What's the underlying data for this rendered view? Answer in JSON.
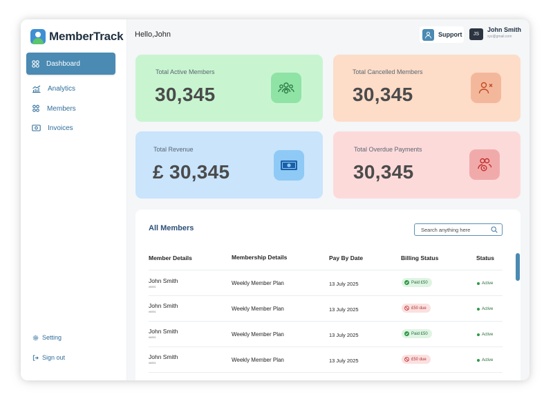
{
  "app": {
    "name": "MemberTrack"
  },
  "sidebar": {
    "items": [
      {
        "label": "Dashboard",
        "icon": "dashboard-icon",
        "active": true
      },
      {
        "label": "Analytics",
        "icon": "analytics-icon",
        "active": false
      },
      {
        "label": "Members",
        "icon": "members-icon",
        "active": false
      },
      {
        "label": "Invoices",
        "icon": "invoices-icon",
        "active": false
      }
    ],
    "bottom": [
      {
        "label": "Setting",
        "icon": "gear-icon"
      },
      {
        "label": "Sign out",
        "icon": "sign-out-icon"
      }
    ]
  },
  "header": {
    "greeting": "Hello,John",
    "support_label": "Support",
    "user": {
      "initials": "JS",
      "name": "John Smith",
      "email": "xyz@gmail.com"
    }
  },
  "stats": [
    {
      "label": "Total Active Members",
      "value": "30,345",
      "icon": "active-members-icon",
      "bg": "#c8f5d0",
      "icon_bg": "#8fe3a5",
      "icon_color": "#2c7a45"
    },
    {
      "label": "Total Cancelled Members",
      "value": "30,345",
      "icon": "cancelled-member-icon",
      "bg": "#fddcc8",
      "icon_bg": "#f3b89b",
      "icon_color": "#c24a23"
    },
    {
      "label": "Total Revenue",
      "value": "£ 30,345",
      "icon": "money-icon",
      "bg": "#c9e4fb",
      "icon_bg": "#8ecaf5",
      "icon_color": "#1a5ea8"
    },
    {
      "label": "Total Overdue Payments",
      "value": "30,345",
      "icon": "overdue-payment-icon",
      "bg": "#fddada",
      "icon_bg": "#f1aaaa",
      "icon_color": "#c22e2e"
    }
  ],
  "table": {
    "title": "All Members",
    "search_placeholder": "Search anything here",
    "columns": [
      "Member Details",
      "Membership Details",
      "Pay By Date",
      "Billing Status",
      "Status"
    ],
    "rows": [
      {
        "name": "John Smith",
        "member_id": "#M001",
        "plan": "Weekly Member Plan",
        "pay_by": "13  July 2025",
        "billing": "Paid £50",
        "billing_type": "paid",
        "status": "Active"
      },
      {
        "name": "John Smith",
        "member_id": "#M001",
        "plan": "Weekly Member Plan",
        "pay_by": "13  July 2025",
        "billing": "£50 due",
        "billing_type": "due",
        "status": "Active"
      },
      {
        "name": "John Smith",
        "member_id": "#M001",
        "plan": "Weekly Member Plan",
        "pay_by": "13  July 2025",
        "billing": "Paid £50",
        "billing_type": "paid",
        "status": "Active"
      },
      {
        "name": "John Smith",
        "member_id": "#M001",
        "plan": "Weekly Member Plan",
        "pay_by": "13  July 2025",
        "billing": "£50 due",
        "billing_type": "due",
        "status": "Active"
      }
    ]
  },
  "colors": {
    "accent": "#4a8ab3",
    "nav_text": "#2f6d9a",
    "title": "#2c4f7a"
  }
}
